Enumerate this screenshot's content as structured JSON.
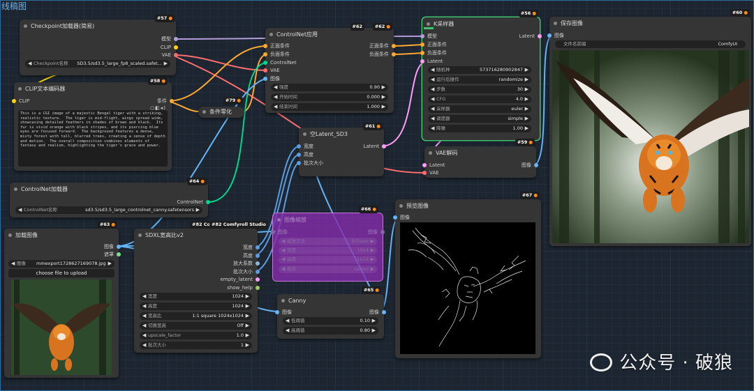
{
  "group": {
    "title": "线稿图"
  },
  "nodes": {
    "ckpt": {
      "title": "Checkpoint加载器(简易)",
      "badge": "#57",
      "out": [
        "模型",
        "CLIP",
        "VAE"
      ],
      "w": {
        "label": "Checkpoint名称",
        "value": "SD3.5/sd3.5_large_fp8_scaled.safet..."
      }
    },
    "clip": {
      "title": "CLIP文本编码器",
      "badge": "#58",
      "in": "CLIP",
      "out": "条件",
      "text": "This is a CGI image of a majestic Bengal tiger with a striking, realistic texture.  The tiger is mid-flight, wings spread wide, showcasing detailed feathers in shades of brown and black.  Its fur is vivid orange with black stripes, and its piercing blue eyes are focused forward.  The background features a dense, misty forest with tall, blurred trees, creating a sense of depth and motion.  The overall composition combines elements of fantasy and realism, highlighting the tiger's grace and power."
    },
    "zero": {
      "title": "条件零化",
      "badge": "#79"
    },
    "cnload": {
      "title": "ControlNet加载器",
      "badge": "#64",
      "out": "ControlNet",
      "w": {
        "label": "ControlNet名称",
        "value": "sd3.5/sd3.5_large_controlnet_canny.safetensors"
      }
    },
    "cnapply": {
      "title": "ControlNet应用",
      "badge1": "#62",
      "badge2": "#62",
      "in": [
        "正面条件",
        "负面条件",
        "ControlNet",
        "VAE",
        "图像"
      ],
      "out": [
        "正面条件",
        "负面条件"
      ],
      "w": [
        {
          "label": "强度",
          "value": "0.90"
        },
        {
          "label": "开始时间",
          "value": "0.000"
        },
        {
          "label": "结束时间",
          "value": "1.000"
        }
      ]
    },
    "latent": {
      "title": "空Latent_SD3",
      "badge": "#61",
      "in": [
        "宽度",
        "高度",
        "批次大小"
      ],
      "out": "Latent"
    },
    "ksampler": {
      "title": "K采样器",
      "badge": "#56",
      "in": [
        "模型",
        "正面条件",
        "负面条件",
        "Latent"
      ],
      "out": "Latent",
      "w": [
        {
          "label": "随机种",
          "value": "573716280902847"
        },
        {
          "label": "运行后操作",
          "value": "randomize"
        },
        {
          "label": "步数",
          "value": "30"
        },
        {
          "label": "CFG",
          "value": "4.0"
        },
        {
          "label": "采样器",
          "value": "euler"
        },
        {
          "label": "调度器",
          "value": "simple"
        },
        {
          "label": "降噪",
          "value": "1.00"
        }
      ]
    },
    "vae": {
      "title": "VAE解码",
      "badge": "#59",
      "in": [
        "Latent",
        "VAE"
      ],
      "out": "图像"
    },
    "save": {
      "title": "保存图像",
      "badge": "#60",
      "in": "图像",
      "w": {
        "label": "文件名前缀",
        "value": "ComfyUI"
      }
    },
    "loadimg": {
      "title": "加载图像",
      "badge": "#63",
      "out": [
        "图像",
        "遮罩"
      ],
      "w": {
        "label": "图像",
        "value": "mmexport1728627169078.jpg"
      },
      "upload": "choose file to upload"
    },
    "sdxl": {
      "title": "SDXL宽高比v2",
      "badge1": "#82 Cor",
      "badge2": "#82 Comfyroll Studio",
      "out": [
        "宽度",
        "高度",
        "放大系数",
        "批次大小",
        "empty_latent",
        "show_help"
      ],
      "w": [
        {
          "label": "宽度",
          "value": "1024"
        },
        {
          "label": "高度",
          "value": "1024"
        },
        {
          "label": "宽高比",
          "value": "1:1 square 1024x1024"
        },
        {
          "label": "切换宽高",
          "value": "Off"
        },
        {
          "label": "upscale_factor",
          "value": "1.0"
        },
        {
          "label": "批次大小",
          "value": "1"
        }
      ]
    },
    "scale": {
      "title": "图像缩放",
      "badge": "#66",
      "in": "图像",
      "out": "图像",
      "w": [
        {
          "label": "缩放方法",
          "value": "bilinear"
        },
        {
          "label": "宽度",
          "value": "1024"
        },
        {
          "label": "高度",
          "value": "1024"
        },
        {
          "label": "裁剪",
          "value": "center"
        }
      ]
    },
    "canny": {
      "title": "Canny",
      "badge": "#65",
      "in": "图像",
      "out": "图像",
      "w": [
        {
          "label": "低阈值",
          "value": "0.10"
        },
        {
          "label": "高阈值",
          "value": "0.80"
        }
      ]
    },
    "preview": {
      "title": "预览图像",
      "badge": "#67",
      "in": "图像"
    }
  },
  "colors": {
    "model": "#b39ddb",
    "clip": "#ffd500",
    "vae": "#ff6e6e",
    "cond": "#ffa931",
    "controlnet": "#00d78d",
    "image": "#64b5f6",
    "latent": "#ff9cf9",
    "int": "#5c9ce0",
    "group": "#6fb2e6",
    "selected": "#3fc46e",
    "bypass": "#8a2db0"
  },
  "watermark": {
    "text": "公众号 · 破狼"
  }
}
